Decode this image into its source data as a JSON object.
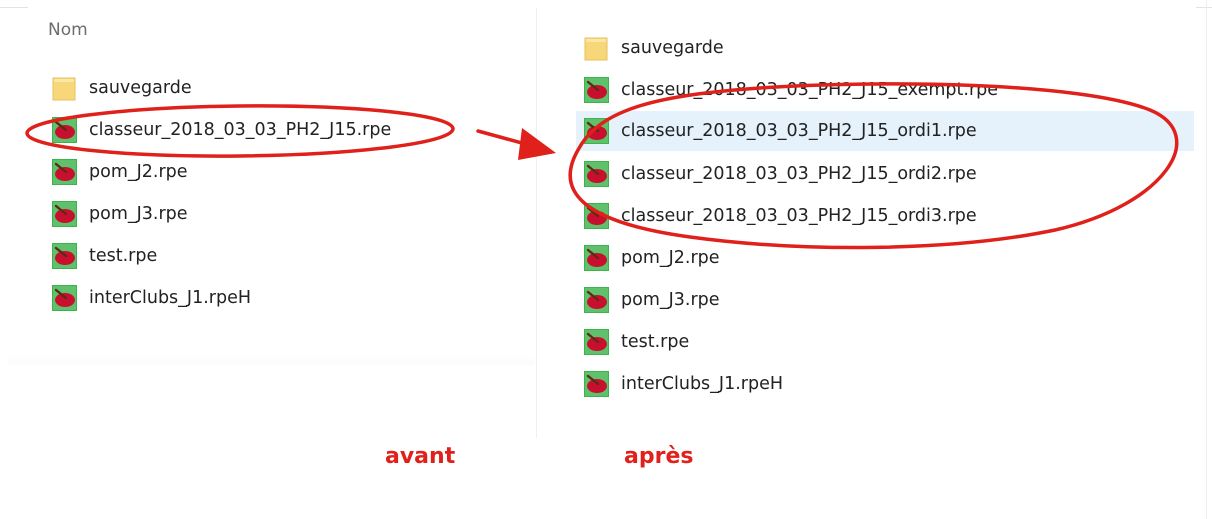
{
  "left_pane": {
    "column_header": "Nom",
    "files": [
      {
        "name": "sauvegarde",
        "type": "folder-icon"
      },
      {
        "name": "classeur_2018_03_03_PH2_J15.rpe",
        "type": "rpe-file-icon"
      },
      {
        "name": "pom_J2.rpe",
        "type": "rpe-file-icon"
      },
      {
        "name": "pom_J3.rpe",
        "type": "rpe-file-icon"
      },
      {
        "name": "test.rpe",
        "type": "rpe-file-icon"
      },
      {
        "name": "interClubs_J1.rpeH",
        "type": "rpe-file-icon"
      }
    ],
    "caption": "avant"
  },
  "right_pane": {
    "files": [
      {
        "name": "sauvegarde",
        "type": "folder-icon"
      },
      {
        "name": "classeur_2018_03_03_PH2_J15_exempt.rpe",
        "type": "rpe-file-icon"
      },
      {
        "name": "classeur_2018_03_03_PH2_J15_ordi1.rpe",
        "type": "rpe-file-icon",
        "selected": true
      },
      {
        "name": "classeur_2018_03_03_PH2_J15_ordi2.rpe",
        "type": "rpe-file-icon"
      },
      {
        "name": "classeur_2018_03_03_PH2_J15_ordi3.rpe",
        "type": "rpe-file-icon"
      },
      {
        "name": "pom_J2.rpe",
        "type": "rpe-file-icon"
      },
      {
        "name": "pom_J3.rpe",
        "type": "rpe-file-icon"
      },
      {
        "name": "test.rpe",
        "type": "rpe-file-icon"
      },
      {
        "name": "interClubs_J1.rpeH",
        "type": "rpe-file-icon"
      }
    ],
    "caption": "après"
  },
  "colors": {
    "annotation_red": "#e0201a",
    "selection": "#e5f1fb",
    "folder": "#f8d77a",
    "rpe_icon_bg": "#3cb44b",
    "rpe_icon_fg": "#c8102e"
  }
}
